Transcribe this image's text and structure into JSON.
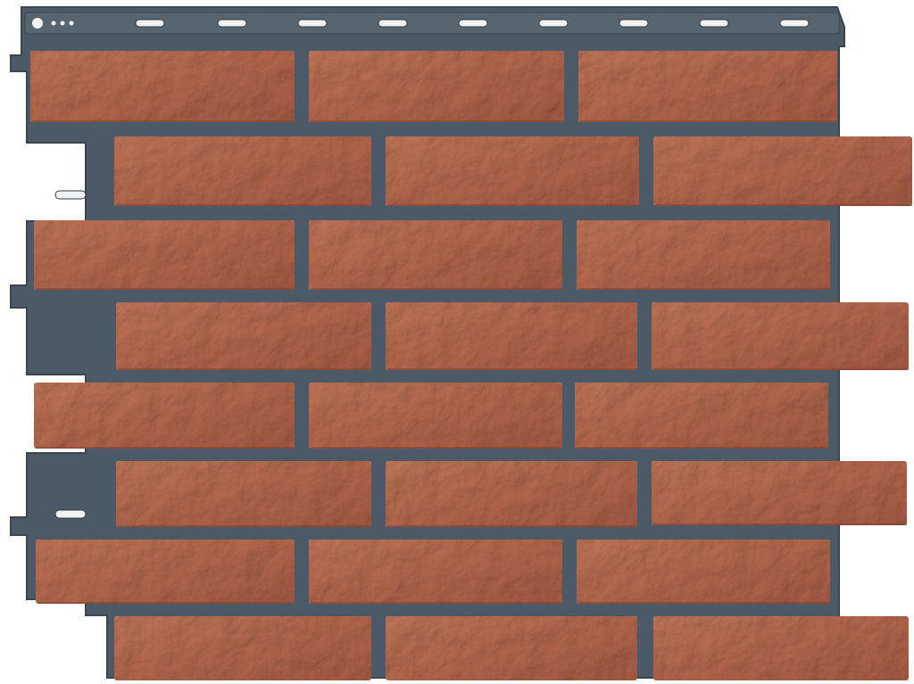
{
  "image": {
    "subject": "facade-panel",
    "colors": {
      "background": "#ffffff",
      "substrate": "#4b5a66",
      "substrate_edge": "#3a4651",
      "mortar": "#55636e",
      "brick_base": "#b96a4e",
      "brick_light": "#c98064",
      "brick_dark": "#8f4b36",
      "slot": "#f2f2f2"
    },
    "rows": 8,
    "bricks_per_row": 3
  }
}
